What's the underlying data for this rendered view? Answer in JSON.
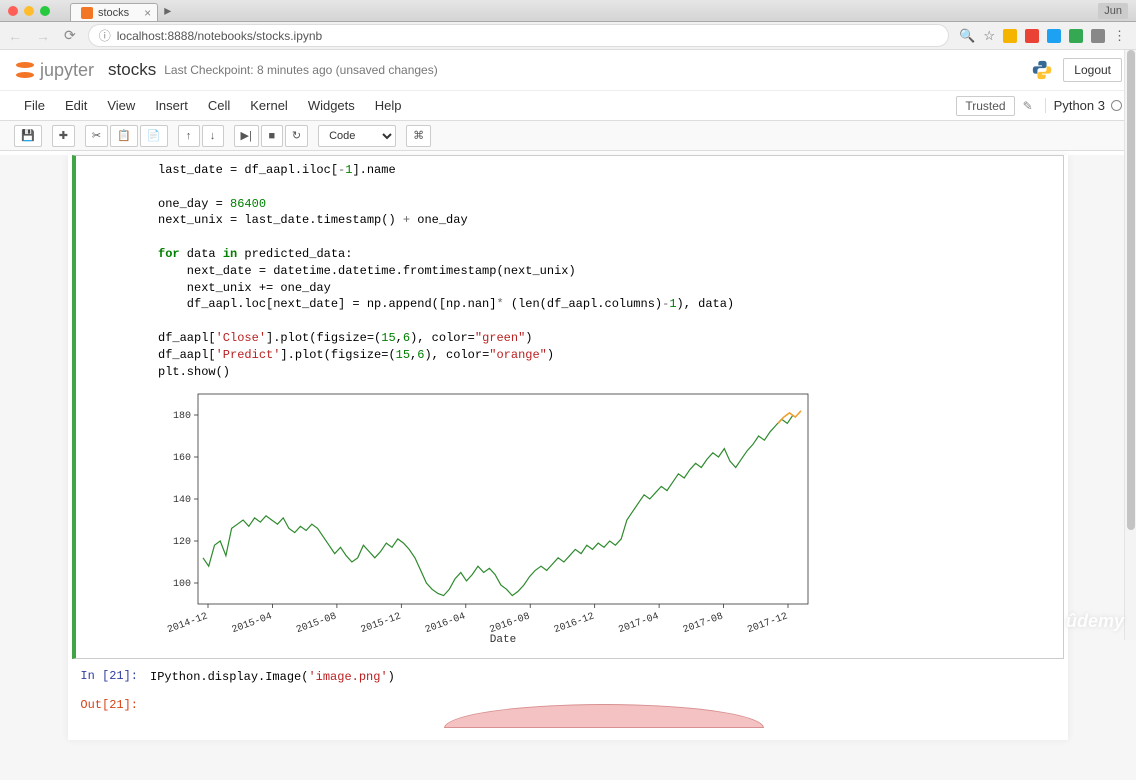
{
  "browser": {
    "tab_title": "stocks",
    "url": "localhost:8888/notebooks/stocks.ipynb",
    "profile": "Jun"
  },
  "header": {
    "logo_text": "jupyter",
    "notebook_name": "stocks",
    "checkpoint": "Last Checkpoint: 8 minutes ago (unsaved changes)",
    "logout": "Logout"
  },
  "menu": {
    "items": [
      "File",
      "Edit",
      "View",
      "Insert",
      "Cell",
      "Kernel",
      "Widgets",
      "Help"
    ],
    "trusted": "Trusted",
    "kernel": "Python 3"
  },
  "toolbar": {
    "cell_type": "Code"
  },
  "cells": {
    "code_block": "last_date = df_aapl.iloc[-1].name\n\none_day = 86400\nnext_unix = last_date.timestamp() + one_day\n\nfor data in predicted_data:\n    next_date = datetime.datetime.fromtimestamp(next_unix)\n    next_unix += one_day\n    df_aapl.loc[next_date] = np.append([np.nan]* (len(df_aapl.columns)-1), data)\n\ndf_aapl['Close'].plot(figsize=(15,6), color=\"green\")\ndf_aapl['Predict'].plot(figsize=(15,6), color=\"orange\")\nplt.show()",
    "in_21_prompt": "In [21]:",
    "in_21_code": "IPython.display.Image('image.png')",
    "out_21_prompt": "Out[21]:"
  },
  "chart_data": {
    "type": "line",
    "xlabel": "Date",
    "ylabel": "",
    "ylim": [
      90,
      190
    ],
    "y_ticks": [
      100,
      120,
      140,
      160,
      180
    ],
    "x_ticks": [
      "2014-12",
      "2015-04",
      "2015-08",
      "2015-12",
      "2016-04",
      "2016-08",
      "2016-12",
      "2017-04",
      "2017-08",
      "2017-12"
    ],
    "series": [
      {
        "name": "Close",
        "color": "#2d8a2d",
        "values": [
          112,
          108,
          118,
          120,
          113,
          126,
          128,
          130,
          127,
          131,
          129,
          132,
          130,
          128,
          131,
          126,
          124,
          127,
          125,
          128,
          126,
          122,
          118,
          114,
          117,
          113,
          110,
          112,
          118,
          115,
          112,
          115,
          119,
          117,
          121,
          119,
          116,
          112,
          106,
          100,
          97,
          95,
          94,
          97,
          102,
          105,
          101,
          104,
          108,
          105,
          107,
          104,
          99,
          97,
          94,
          96,
          99,
          103,
          106,
          108,
          106,
          109,
          112,
          110,
          113,
          116,
          114,
          118,
          116,
          119,
          117,
          120,
          118,
          121,
          130,
          134,
          138,
          142,
          140,
          143,
          146,
          144,
          148,
          152,
          150,
          154,
          157,
          155,
          159,
          162,
          160,
          164,
          158,
          155,
          159,
          163,
          166,
          170,
          168,
          172,
          175,
          178,
          176,
          180
        ]
      },
      {
        "name": "Predict",
        "color": "#f0a030",
        "values_tail": [
          176,
          179,
          181,
          179,
          182
        ]
      }
    ]
  }
}
